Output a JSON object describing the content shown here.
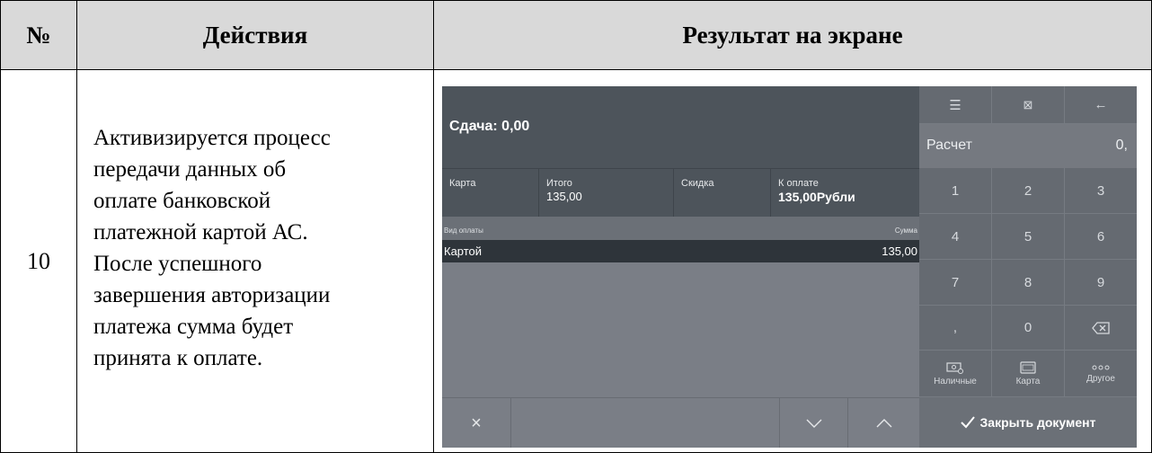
{
  "table": {
    "headers": {
      "num": "№",
      "actions": "Действия",
      "result": "Результат на экране"
    },
    "row": {
      "num": "10",
      "action_lines": [
        "Активизируется процесс",
        "передачи данных об",
        "оплате банковской",
        "платежной картой АС.",
        "После успешного",
        "завершения авторизации",
        "платежа сумма будет",
        "принята к оплате."
      ]
    }
  },
  "screen": {
    "change": "Сдача: 0,00",
    "totals": {
      "card_label": "Карта",
      "total_label": "Итого",
      "total_value": "135,00",
      "discount_label": "Скидка",
      "due_label": "К оплате",
      "due_value": "135,00Рубли"
    },
    "list": {
      "col_type": "Вид оплаты",
      "col_sum": "Сумма",
      "rows": [
        {
          "type": "Картой",
          "sum": "135,00"
        }
      ]
    },
    "bottom": {
      "cancel": "×",
      "down": "﹀",
      "up": "︿"
    },
    "keypad": {
      "top_icons": {
        "menu": "☰",
        "cancel": "⊠",
        "back": "←"
      },
      "display_label": "Расчет",
      "display_value": "0,",
      "digits": [
        "1",
        "2",
        "3",
        "4",
        "5",
        "6",
        "7",
        "8",
        "9",
        ",",
        "0",
        "⌫"
      ],
      "pay_methods": [
        {
          "icon": "cash-icon",
          "label": "Наличные"
        },
        {
          "icon": "card-icon",
          "label": "Карта"
        },
        {
          "icon": "dots-icon",
          "label": "Другое"
        }
      ],
      "close": "Закрыть документ"
    }
  }
}
